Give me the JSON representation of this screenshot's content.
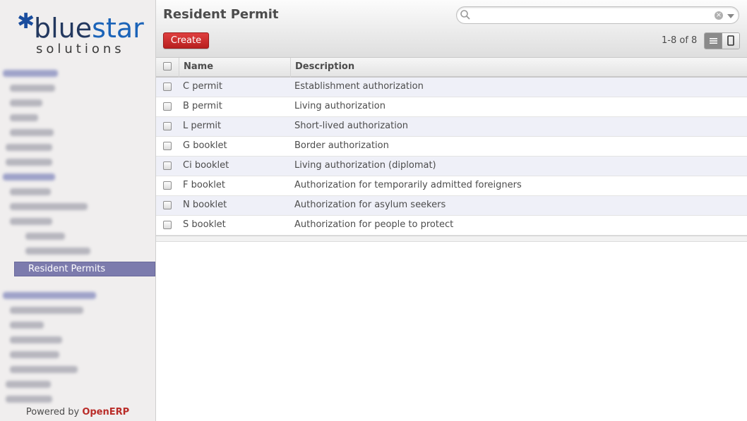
{
  "brand": {
    "logo_word_blue": "blue",
    "logo_word_star": "star",
    "logo_sub": "solutions",
    "color_primary": "#1b63b8"
  },
  "sidebar": {
    "active_item": "Resident Permits",
    "powered_prefix": "Powered by",
    "powered_brand": "OpenERP"
  },
  "header": {
    "title": "Resident Permit",
    "create_label": "Create",
    "pager": "1-8 of 8",
    "search_placeholder": ""
  },
  "table": {
    "columns": [
      "Name",
      "Description"
    ],
    "rows": [
      {
        "name": "C permit",
        "description": "Establishment authorization"
      },
      {
        "name": "B permit",
        "description": "Living authorization"
      },
      {
        "name": "L permit",
        "description": "Short-lived authorization"
      },
      {
        "name": "G booklet",
        "description": "Border authorization"
      },
      {
        "name": "Ci booklet",
        "description": "Living authorization (diplomat)"
      },
      {
        "name": "F booklet",
        "description": "Authorization for temporarily admitted foreigners"
      },
      {
        "name": "N booklet",
        "description": "Authorization for asylum seekers"
      },
      {
        "name": "S booklet",
        "description": "Authorization for people to protect"
      }
    ]
  }
}
